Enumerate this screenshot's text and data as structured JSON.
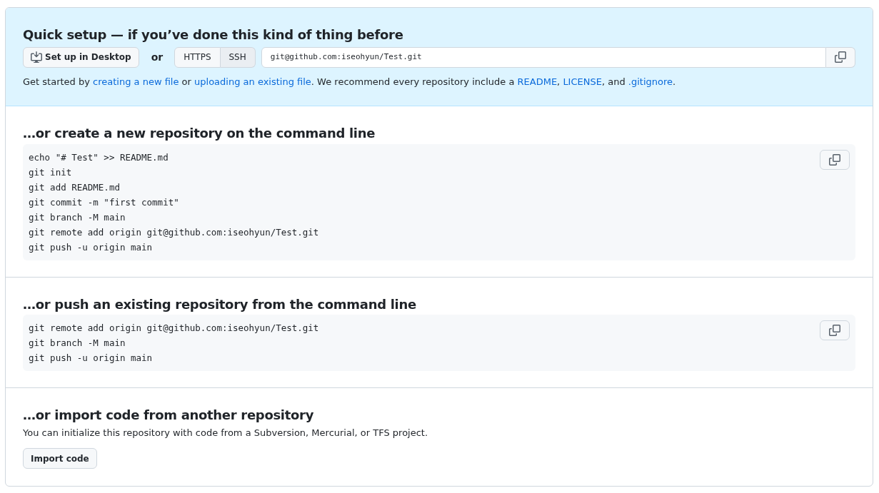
{
  "quick_setup": {
    "title": "Quick setup — if you’ve done this kind of thing before",
    "desktop_button": "Set up in Desktop",
    "or": "or",
    "protocols": [
      {
        "label": "HTTPS",
        "selected": false
      },
      {
        "label": "SSH",
        "selected": true
      }
    ],
    "clone_url": "git@github.com:iseohyun/Test.git",
    "intro": [
      {
        "kind": "text",
        "text": "Get started by "
      },
      {
        "kind": "link",
        "text": "creating a new file"
      },
      {
        "kind": "text",
        "text": " or "
      },
      {
        "kind": "link",
        "text": "uploading an existing file"
      },
      {
        "kind": "text",
        "text": ". We recommend every repository include a "
      },
      {
        "kind": "link",
        "text": "README"
      },
      {
        "kind": "text",
        "text": ", "
      },
      {
        "kind": "link",
        "text": "LICENSE"
      },
      {
        "kind": "text",
        "text": ", and "
      },
      {
        "kind": "link",
        "text": ".gitignore"
      },
      {
        "kind": "text",
        "text": "."
      }
    ]
  },
  "sections": [
    {
      "title": "…or create a new repository on the command line",
      "code": [
        "echo \"# Test\" >> README.md",
        "git init",
        "git add README.md",
        "git commit -m \"first commit\"",
        "git branch -M main",
        "git remote add origin git@github.com:iseohyun/Test.git",
        "git push -u origin main"
      ]
    },
    {
      "title": "…or push an existing repository from the command line",
      "code": [
        "git remote add origin git@github.com:iseohyun/Test.git",
        "git branch -M main",
        "git push -u origin main"
      ]
    }
  ],
  "import": {
    "title": "…or import code from another repository",
    "text": "You can initialize this repository with code from a Subversion, Mercurial, or TFS project.",
    "button": "Import code"
  }
}
